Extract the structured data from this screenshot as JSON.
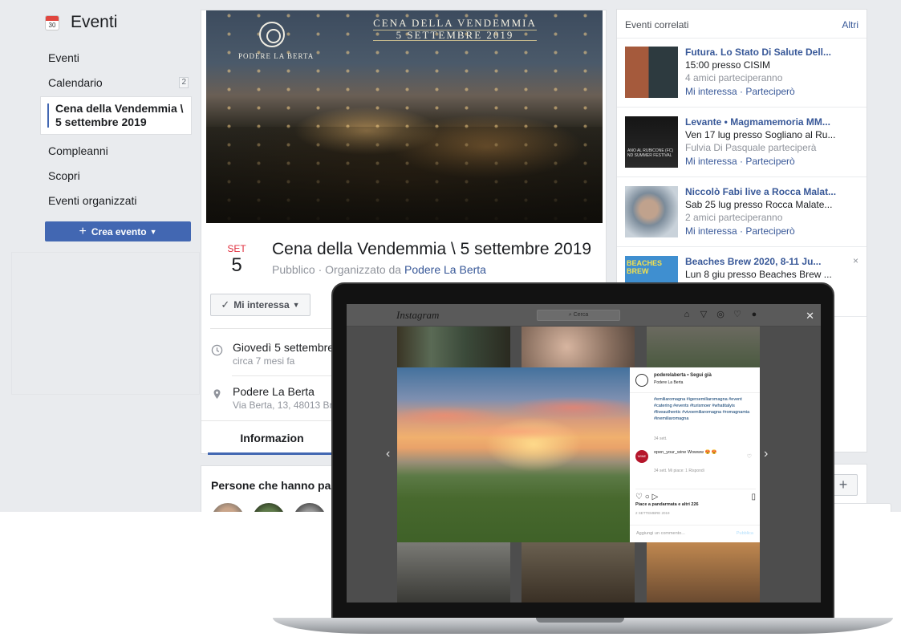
{
  "sidebar": {
    "title": "Eventi",
    "calendar_icon_day": "30",
    "items": [
      {
        "label": "Eventi"
      },
      {
        "label": "Calendario",
        "count": "2"
      },
      {
        "label": "Cena della Vendemmia \\ 5 settembre 2019"
      },
      {
        "label": "Compleanni"
      },
      {
        "label": "Scopri"
      },
      {
        "label": "Eventi organizzati"
      }
    ],
    "create_button": "Crea evento"
  },
  "event": {
    "cover": {
      "brand": "PODERE LA BERTA",
      "title_line1": "CENA DELLA VENDEMMIA",
      "title_line2": "5 SETTEMBRE 2019"
    },
    "month": "SET",
    "day": "5",
    "title": "Cena della Vendemmia \\ 5 settembre 2019",
    "subtitle_prefix": "Pubblico · Organizzato da ",
    "organizer": "Podere La Berta",
    "interest_button": "Mi interessa",
    "date_main": "Giovedì 5 settembre",
    "date_sub": "circa 7 mesi fa",
    "place_main": "Podere La Berta",
    "place_sub": "Via Berta, 13, 48013 Bri",
    "tab_info": "Informazion",
    "people_title": "Persone che hanno part"
  },
  "related": {
    "header": "Eventi correlati",
    "more": "Altri",
    "items": [
      {
        "title": "Futura. Lo Stato Di Salute Dell...",
        "line2": "15:00 presso CISIM",
        "line3": "4 amici parteciperanno",
        "links": "Mi interessa · Parteciperò"
      },
      {
        "title": "Levante • Magmamemoria MM...",
        "line2": "Ven 17 lug presso Sogliano al Ru...",
        "line3": "Fulvia Di Pasquale parteciperà",
        "links": "Mi interessa · Parteciperò"
      },
      {
        "title": "Niccolò Fabi live a Rocca Malat...",
        "line2": "Sab 25 lug presso Rocca Malate...",
        "line3": "2 amici parteciperanno",
        "links": "Mi interessa · Parteciperò"
      },
      {
        "title": "Beaches Brew 2020, 8-11 Ju...",
        "line2": "Lun 8 giu presso Beaches Brew ...",
        "close": "×"
      }
    ],
    "thumb2_text": "ANO AL RUBICONE (FC) ND SUMMER FESTIVAL",
    "thumb4_text": "BEACHES BREW"
  },
  "instagram": {
    "logo": "Instagram",
    "search_placeholder": "Cerca",
    "username": "poderelaberta • Segui già",
    "location": "Podere La Berta",
    "hashtags": "#emiliaromagna #igersemiliaromagna #event #catering #events #turismoer #whatitalyis #liveauthentic #vivoemiliaromagna #romagnamia #inemiliaromagna",
    "time1": "34 sett.",
    "comment": "open_your_wine Wowww 😍 😍",
    "comment_avatar": "WINE",
    "comment_meta": "34 sett.   Mi piace: 1   Rispondi",
    "likes": "Piace a pandarmata e altri 226",
    "date": "2 SETTEMBRE 2019",
    "add_comment": "Aggiungi un commento...",
    "publish": "Pubblica"
  }
}
